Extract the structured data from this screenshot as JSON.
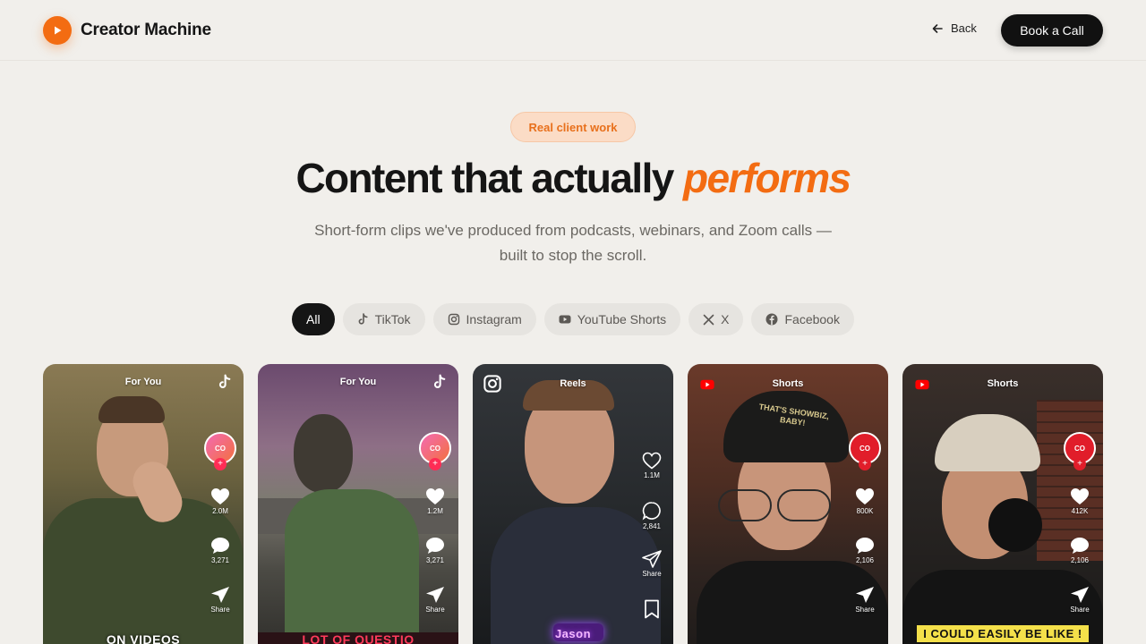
{
  "header": {
    "brand": "Creator Machine",
    "back_label": "Back",
    "cta_label": "Book a Call"
  },
  "hero": {
    "badge": "Real client work",
    "title_main": "Content that actually",
    "title_accent": "performs",
    "subtitle": "Short-form clips we've produced from podcasts, webinars, and Zoom calls — built to stop the scroll."
  },
  "filters": [
    {
      "label": "All",
      "icon": "none",
      "active": true
    },
    {
      "label": "TikTok",
      "icon": "tiktok-icon",
      "active": false
    },
    {
      "label": "Instagram",
      "icon": "instagram-icon",
      "active": false
    },
    {
      "label": "YouTube Shorts",
      "icon": "youtube-icon",
      "active": false
    },
    {
      "label": "X",
      "icon": "x-icon",
      "active": false
    },
    {
      "label": "Facebook",
      "icon": "facebook-icon",
      "active": false
    }
  ],
  "cards": [
    {
      "platform": "TikTok",
      "label": "For You",
      "avatar": "CO",
      "likes": "2.0M",
      "comments": "3,271",
      "share": "Share",
      "caption": "ON VIDEOS"
    },
    {
      "platform": "TikTok",
      "label": "For You",
      "avatar": "CO",
      "likes": "1.2M",
      "comments": "3,271",
      "share": "Share",
      "caption": "LOT OF QUESTIO"
    },
    {
      "platform": "Instagram",
      "label": "Reels",
      "likes": "1.1M",
      "comments": "2,841",
      "share": "Share",
      "caption": "Jason"
    },
    {
      "platform": "YouTube",
      "label": "Shorts",
      "avatar": "CO",
      "likes": "800K",
      "comments": "2,106",
      "share": "Share",
      "cap_text": "THAT'S SHOWBIZ, BABY!"
    },
    {
      "platform": "YouTube",
      "label": "Shorts",
      "avatar": "CO",
      "likes": "412K",
      "comments": "2,106",
      "share": "Share",
      "caption": "I COULD EASILY BE LIKE !"
    }
  ],
  "colors": {
    "accent": "#f36c12",
    "background": "#f1efeb",
    "dark": "#111111",
    "badge_bg": "#fbdcc6"
  }
}
